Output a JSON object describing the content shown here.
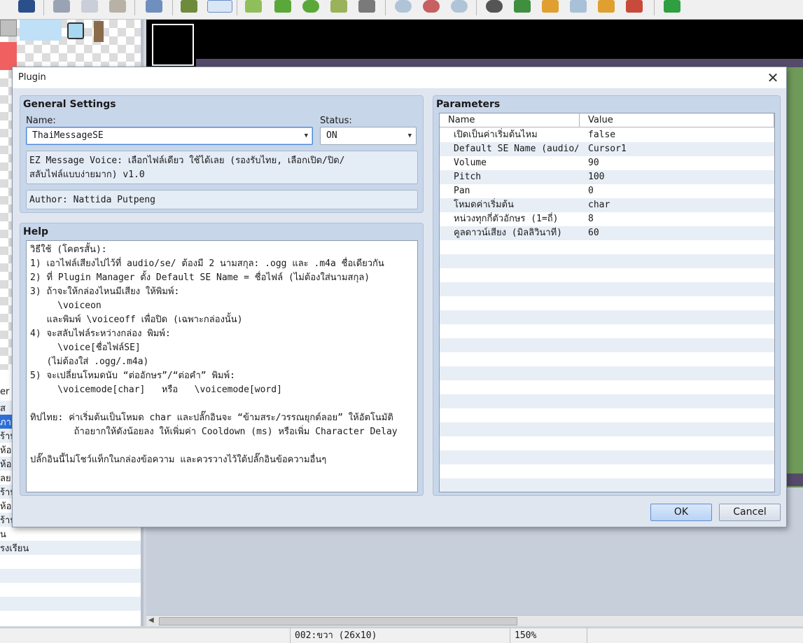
{
  "dialog": {
    "title": "Plugin",
    "close_glyph": "✕",
    "general": {
      "title": "General Settings",
      "name_label": "Name:",
      "name_value": "ThaiMessageSE",
      "status_label": "Status:",
      "status_value": "ON",
      "description": "EZ Message Voice: เลือกไฟล์เดียว ใช้ได้เลย (รองรับไทย, เลือกเปิด/ปิด/\nสลับไฟล์แบบง่ายมาก) v1.0",
      "author": "Author: Nattida Putpeng"
    },
    "help": {
      "title": "Help",
      "text": "วิธีใช้ (โคตรสั้น):\n1) เอาไฟล์เสียงไปไว้ที่ audio/se/ ต้องมี 2 นามสกุล: .ogg และ .m4a ชื่อเดียวกัน\n2) ที่ Plugin Manager ตั้ง Default SE Name = ชื่อไฟล์ (ไม่ต้องใส่นามสกุล)\n3) ถ้าจะให้กล่องไหนมีเสียง ให้พิมพ์:\n     \\voiceon\n   และพิมพ์ \\voiceoff เพื่อปิด (เฉพาะกล่องนั้น)\n4) จะสลับไฟล์ระหว่างกล่อง พิมพ์:\n     \\voice[ชื่อไฟล์SE]\n   (ไม่ต้องใส่ .ogg/.m4a)\n5) จะเปลี่ยนโหมดนับ “ต่ออักษร”/“ต่อคำ” พิมพ์:\n     \\voicemode[char]   หรือ   \\voicemode[word]\n\nทิปไทย: ค่าเริ่มต้นเป็นโหมด char และปลั๊กอินจะ “ข้ามสระ/วรรณยุกต์ลอย” ให้อัตโนมัติ\n        ถ้าอยากให้ดังน้อยลง ให้เพิ่มค่า Cooldown (ms) หรือเพิ่ม Character Delay\n\nปลั๊กอินนี้ไม่โชว์แท็กในกล่องข้อความ และควรวางไว้ใต้ปลั๊กอินข้อความอื่นๆ"
    },
    "parameters": {
      "title": "Parameters",
      "col_name": "Name",
      "col_value": "Value",
      "rows": [
        {
          "name": "เปิดเป็นค่าเริ่มต้นไหม",
          "value": "false"
        },
        {
          "name": "Default SE Name (audio/…",
          "value": "Cursor1"
        },
        {
          "name": "Volume",
          "value": "90"
        },
        {
          "name": "Pitch",
          "value": "100"
        },
        {
          "name": "Pan",
          "value": "0"
        },
        {
          "name": "โหมดค่าเริ่มต้น",
          "value": "char"
        },
        {
          "name": "หน่วงทุกกี่ตัวอักษร (1=ถี่)",
          "value": "8"
        },
        {
          "name": "คูลดาวน์เสียง (มิลลิวินาที)",
          "value": "60"
        }
      ]
    },
    "buttons": {
      "ok": "OK",
      "cancel": "Cancel"
    }
  },
  "map_list": {
    "items": [
      "er",
      "ส",
      "ภา",
      "ร้าน",
      "ห้อ",
      "ห้อ",
      "ลย",
      "ร้าน",
      "ห้อ",
      "ร้าน",
      "น",
      "รงเรียน",
      "",
      "",
      "",
      "",
      ""
    ]
  },
  "status_bar": {
    "map_info": "002:ขวา (26x10)",
    "zoom": "150%"
  },
  "colors": {
    "accent": "#2f6fd6",
    "group_bg": "#c8d6ea",
    "dialog_bg": "#dfe6f0"
  },
  "toolbar_icons": [
    "save-icon",
    "cut-icon",
    "copy-icon",
    "paste-icon",
    "undo-icon",
    "map-layer-icon",
    "event-layer-icon",
    "pencil-icon",
    "rectangle-icon",
    "ellipse-icon",
    "fill-icon",
    "shadow-pen-icon",
    "zoom-in-icon",
    "zoom-out-icon",
    "zoom-actual-icon",
    "database-icon",
    "plugin-manager-icon",
    "sound-test-icon",
    "event-search-icon",
    "resource-manager-icon",
    "character-generator-icon",
    "playtest-icon"
  ]
}
